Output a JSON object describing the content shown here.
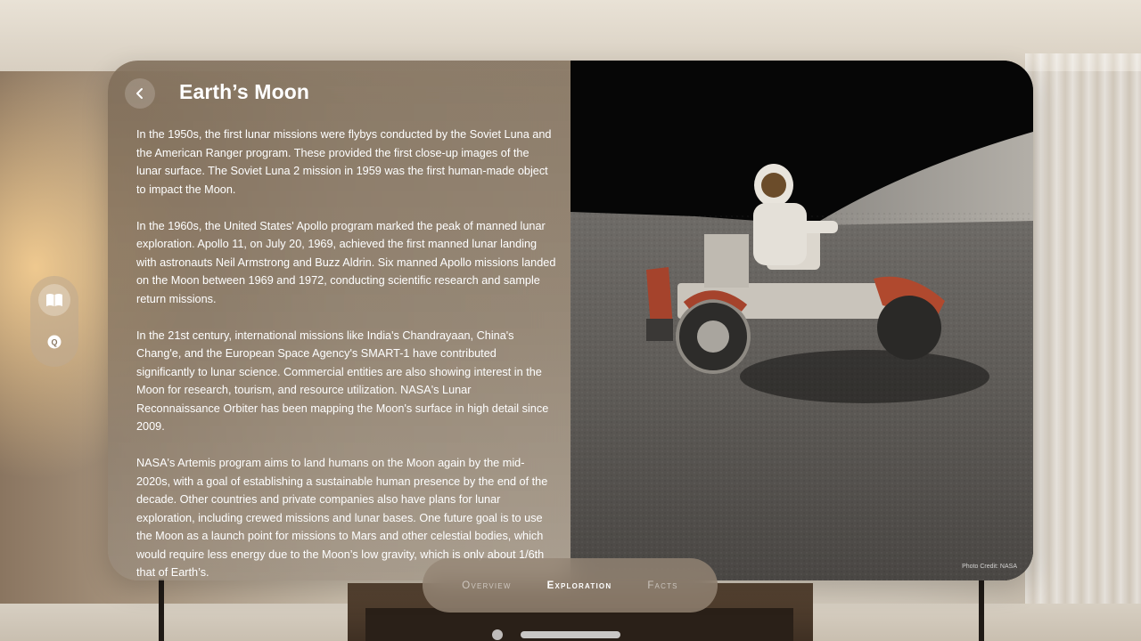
{
  "window": {
    "title": "Earth’s Moon",
    "paragraphs": [
      "In the 1950s, the first lunar missions were flybys conducted by the Soviet Luna and the American Ranger program. These provided the first close-up images of the lunar surface. The Soviet Luna 2 mission in 1959 was the first human-made object to impact the Moon.",
      "In the 1960s, the United States' Apollo program marked the peak of manned lunar exploration. Apollo 11, on July 20, 1969, achieved the first manned lunar landing with astronauts Neil Armstrong and Buzz Aldrin. Six manned Apollo missions landed on the Moon between 1969 and 1972, conducting scientific research and sample return missions.",
      "In the 21st century, international missions like India's Chandrayaan, China's Chang'e, and the European Space Agency's SMART-1 have contributed significantly to lunar science. Commercial entities are also showing interest in the Moon for research, tourism, and resource utilization. NASA's Lunar Reconnaissance Orbiter has been mapping the Moon's surface in high detail since 2009.",
      "NASA's Artemis program aims to land humans on the Moon again by the mid-2020s, with a goal of establishing a sustainable human presence by the end of the decade. Other countries and private companies also have plans for lunar exploration, including crewed missions and lunar bases. One future goal is to use the Moon as a launch point for missions to Mars and other celestial bodies, which would require less energy due to the Moon’s low gravity, which is only about 1/6th that of Earth’s."
    ],
    "photo_credit": "Photo Credit: NASA"
  },
  "tabs": [
    {
      "label": "Overview",
      "active": false
    },
    {
      "label": "Exploration",
      "active": true
    },
    {
      "label": "Facts",
      "active": false
    }
  ],
  "ornament": {
    "items": [
      {
        "icon": "book-icon",
        "active": true
      },
      {
        "icon": "quiz-icon",
        "glyph": "Q",
        "active": false
      }
    ]
  },
  "icons": {
    "back": "chevron-left-icon"
  },
  "colors": {
    "text": "#ffffff",
    "glass": "#8a7862"
  }
}
